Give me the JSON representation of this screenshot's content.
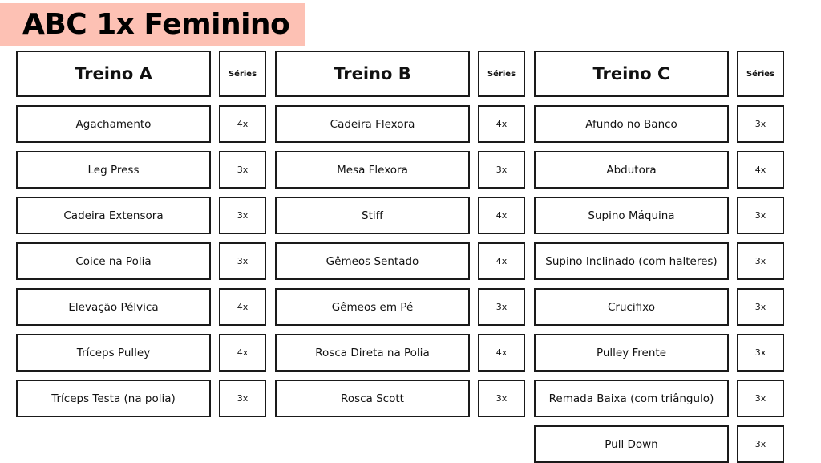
{
  "title": "ABC 1x Feminino",
  "series_label": "Séries",
  "colors": {
    "title_background": "#fdc1b4",
    "border": "#1a1a1a"
  },
  "workouts": [
    {
      "name": "Treino A",
      "exercises": [
        {
          "name": "Agachamento",
          "sets": "4x"
        },
        {
          "name": "Leg Press",
          "sets": "3x"
        },
        {
          "name": "Cadeira Extensora",
          "sets": "3x"
        },
        {
          "name": "Coice na Polia",
          "sets": "3x"
        },
        {
          "name": "Elevação Pélvica",
          "sets": "4x"
        },
        {
          "name": "Tríceps Pulley",
          "sets": "4x"
        },
        {
          "name": "Tríceps Testa (na polia)",
          "sets": "3x"
        }
      ]
    },
    {
      "name": "Treino B",
      "exercises": [
        {
          "name": "Cadeira Flexora",
          "sets": "4x"
        },
        {
          "name": "Mesa Flexora",
          "sets": "3x"
        },
        {
          "name": "Stiff",
          "sets": "4x"
        },
        {
          "name": "Gêmeos Sentado",
          "sets": "4x"
        },
        {
          "name": "Gêmeos em Pé",
          "sets": "3x"
        },
        {
          "name": "Rosca Direta na Polia",
          "sets": "4x"
        },
        {
          "name": "Rosca Scott",
          "sets": "3x"
        }
      ]
    },
    {
      "name": "Treino C",
      "exercises": [
        {
          "name": "Afundo no Banco",
          "sets": "3x"
        },
        {
          "name": "Abdutora",
          "sets": "4x"
        },
        {
          "name": "Supino Máquina",
          "sets": "3x"
        },
        {
          "name": "Supino Inclinado (com halteres)",
          "sets": "3x"
        },
        {
          "name": "Crucifixo",
          "sets": "3x"
        },
        {
          "name": "Pulley Frente",
          "sets": "3x"
        },
        {
          "name": "Remada Baixa (com triângulo)",
          "sets": "3x"
        },
        {
          "name": "Pull Down",
          "sets": "3x"
        }
      ]
    }
  ]
}
